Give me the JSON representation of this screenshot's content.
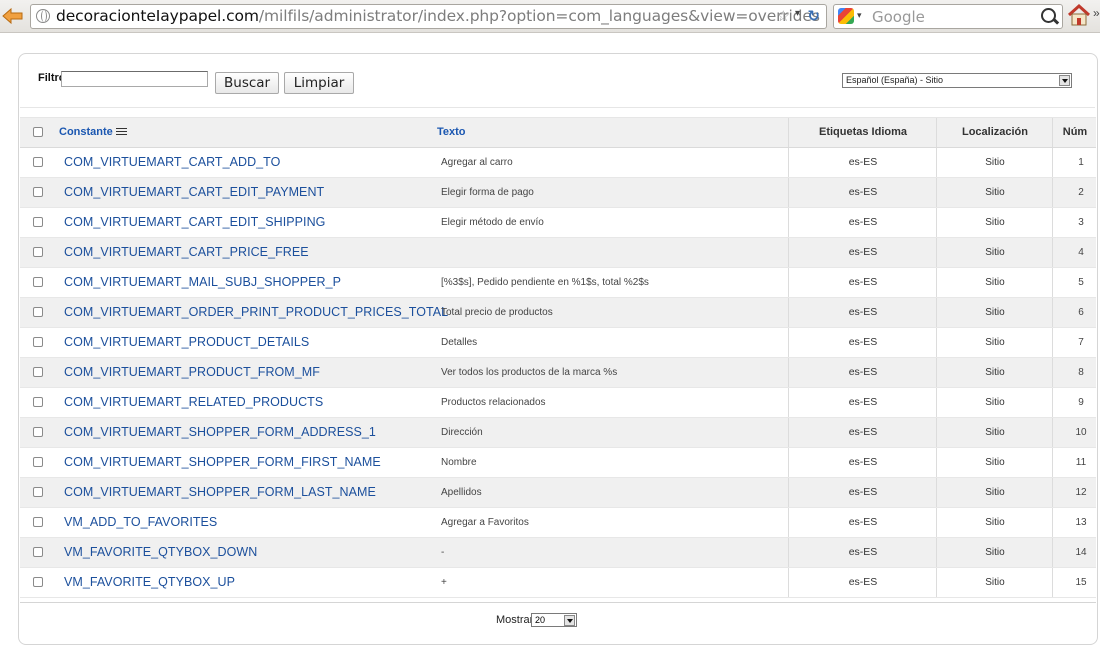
{
  "browser": {
    "url_domain": "decoracionteIaypapel.com",
    "url_path": "/milfils/administrator/index.php?option=com_languages&view=overrides",
    "search_engine": "Google"
  },
  "filter": {
    "label": "Filtro:",
    "value": "",
    "search_button": "Buscar",
    "clear_button": "Limpiar",
    "language_select": "Español (España) - Sitio"
  },
  "table": {
    "headers": {
      "constant": "Constante",
      "text": "Texto",
      "language_tag": "Etiquetas Idioma",
      "location": "Localización",
      "num": "Núm"
    },
    "rows": [
      {
        "constant": "COM_VIRTUEMART_CART_ADD_TO",
        "text": "Agregar al carro",
        "tag": "es-ES",
        "location": "Sitio",
        "num": "1"
      },
      {
        "constant": "COM_VIRTUEMART_CART_EDIT_PAYMENT",
        "text": "Elegir forma de pago",
        "tag": "es-ES",
        "location": "Sitio",
        "num": "2"
      },
      {
        "constant": "COM_VIRTUEMART_CART_EDIT_SHIPPING",
        "text": "Elegir método de envío",
        "tag": "es-ES",
        "location": "Sitio",
        "num": "3"
      },
      {
        "constant": "COM_VIRTUEMART_CART_PRICE_FREE",
        "text": "",
        "tag": "es-ES",
        "location": "Sitio",
        "num": "4"
      },
      {
        "constant": "COM_VIRTUEMART_MAIL_SUBJ_SHOPPER_P",
        "text": "[%3$s], Pedido pendiente en %1$s, total %2$s",
        "tag": "es-ES",
        "location": "Sitio",
        "num": "5"
      },
      {
        "constant": "COM_VIRTUEMART_ORDER_PRINT_PRODUCT_PRICES_TOTAL",
        "text": "Total precio de productos",
        "tag": "es-ES",
        "location": "Sitio",
        "num": "6"
      },
      {
        "constant": "COM_VIRTUEMART_PRODUCT_DETAILS",
        "text": "Detalles",
        "tag": "es-ES",
        "location": "Sitio",
        "num": "7"
      },
      {
        "constant": "COM_VIRTUEMART_PRODUCT_FROM_MF",
        "text": "Ver todos los productos de la marca %s",
        "tag": "es-ES",
        "location": "Sitio",
        "num": "8"
      },
      {
        "constant": "COM_VIRTUEMART_RELATED_PRODUCTS",
        "text": "Productos relacionados",
        "tag": "es-ES",
        "location": "Sitio",
        "num": "9"
      },
      {
        "constant": "COM_VIRTUEMART_SHOPPER_FORM_ADDRESS_1",
        "text": "Dirección",
        "tag": "es-ES",
        "location": "Sitio",
        "num": "10"
      },
      {
        "constant": "COM_VIRTUEMART_SHOPPER_FORM_FIRST_NAME",
        "text": "Nombre",
        "tag": "es-ES",
        "location": "Sitio",
        "num": "11"
      },
      {
        "constant": "COM_VIRTUEMART_SHOPPER_FORM_LAST_NAME",
        "text": "Apellidos",
        "tag": "es-ES",
        "location": "Sitio",
        "num": "12"
      },
      {
        "constant": "VM_ADD_TO_FAVORITES",
        "text": "Agregar a Favoritos",
        "tag": "es-ES",
        "location": "Sitio",
        "num": "13"
      },
      {
        "constant": "VM_FAVORITE_QTYBOX_DOWN",
        "text": "-",
        "tag": "es-ES",
        "location": "Sitio",
        "num": "14"
      },
      {
        "constant": "VM_FAVORITE_QTYBOX_UP",
        "text": "+",
        "tag": "es-ES",
        "location": "Sitio",
        "num": "15"
      }
    ]
  },
  "footer": {
    "show_label": "Mostrar #",
    "show_value": "20"
  },
  "colors": {
    "link": "#1b4f9c",
    "row_alt": "#f0f0f0"
  }
}
